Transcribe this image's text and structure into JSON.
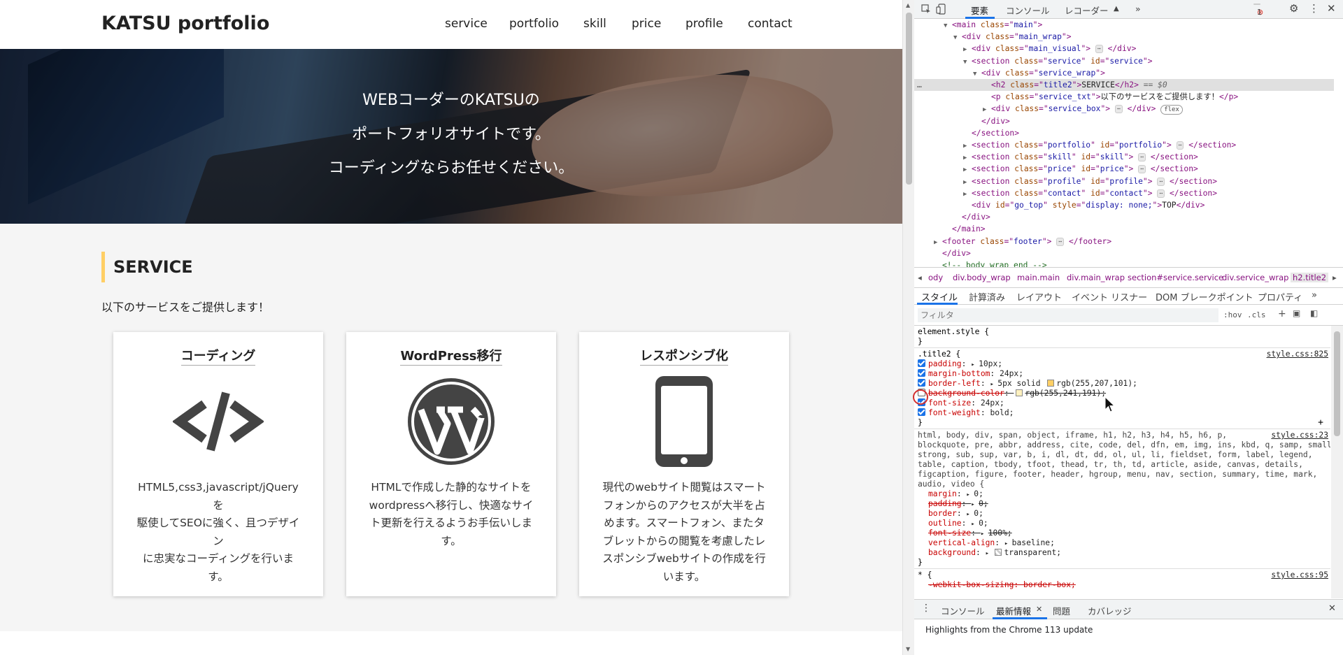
{
  "site": {
    "logo": "KATSU portfolio",
    "nav": [
      "service",
      "portfolio",
      "skill",
      "price",
      "profile",
      "contact"
    ],
    "hero_lines": [
      "WEBコーダーのKATSUの",
      "ポートフォリオサイトです。",
      "コーディングならお任せください。"
    ],
    "service_title": "SERVICE",
    "service_txt": "以下のサービスをご提供します！",
    "cards": [
      {
        "title": "コーディング",
        "icon": "code-icon",
        "desc": [
          "HTML5,css3,javascript/jQueryを",
          "駆使してSEOに強く、且つデザイン",
          "に忠実なコーディングを行いま",
          "す。"
        ]
      },
      {
        "title": "WordPress移行",
        "icon": "wordpress-icon",
        "desc": [
          "HTMLで作成した静的なサイトを",
          "wordpressへ移行し、快適なサイ",
          "ト更新を行えるようお手伝いしま",
          "す。"
        ]
      },
      {
        "title": "レスポンシブ化",
        "icon": "smartphone-icon",
        "desc": [
          "現代のwebサイト閲覧はスマート",
          "フォンからのアクセスが大半を占",
          "めます。スマートフォン、またタ",
          "ブレットからの閲覧を考慮したレ",
          "スポンシブwebサイトの作成を行",
          "います。"
        ]
      }
    ]
  },
  "devtools": {
    "top_tabs": [
      "要素",
      "コンソール",
      "レコーダー",
      "»"
    ],
    "error_count": "1",
    "tree": [
      {
        "indent": 0,
        "tri": "▼",
        "tag": "<main",
        "attrs": [
          [
            "class",
            "main"
          ]
        ],
        "close": ">",
        "after": ""
      },
      {
        "indent": 1,
        "tri": "▼",
        "tag": "<div",
        "attrs": [
          [
            "class",
            "main_wrap"
          ]
        ],
        "close": ">",
        "after": ""
      },
      {
        "indent": 2,
        "tri": "▶",
        "tag": "<div",
        "attrs": [
          [
            "class",
            "main_visual"
          ]
        ],
        "close": ">",
        "after": "</div>",
        "ell": true
      },
      {
        "indent": 2,
        "tri": "▼",
        "tag": "<section",
        "attrs": [
          [
            "class",
            "service"
          ],
          [
            "id",
            "service"
          ]
        ],
        "close": ">",
        "after": ""
      },
      {
        "indent": 3,
        "tri": "▼",
        "tag": "<div",
        "attrs": [
          [
            "class",
            "service_wrap"
          ]
        ],
        "close": ">",
        "after": ""
      },
      {
        "indent": 4,
        "tri": "",
        "tag": "<h2",
        "attrs": [
          [
            "class",
            "title2"
          ]
        ],
        "close": ">",
        "text": "SERVICE",
        "after": "</h2>",
        "selected": true,
        "suffix": " == $0"
      },
      {
        "indent": 4,
        "tri": "",
        "tag": "<p",
        "attrs": [
          [
            "class",
            "service_txt"
          ]
        ],
        "close": ">",
        "text": "以下のサービスをご提供します！",
        "after": "</p>"
      },
      {
        "indent": 4,
        "tri": "▶",
        "tag": "<div",
        "attrs": [
          [
            "class",
            "service_box"
          ]
        ],
        "close": ">",
        "after": "</div>",
        "ell": true,
        "badge": "flex"
      },
      {
        "indent": 3,
        "tri": "",
        "tag": "</div>",
        "attrs": [],
        "close": "",
        "after": ""
      },
      {
        "indent": 2,
        "tri": "",
        "tag": "</section>",
        "attrs": [],
        "close": "",
        "after": ""
      },
      {
        "indent": 2,
        "tri": "▶",
        "tag": "<section",
        "attrs": [
          [
            "class",
            "portfolio"
          ],
          [
            "id",
            "portfolio"
          ]
        ],
        "close": ">",
        "after": "</section>",
        "ell": true
      },
      {
        "indent": 2,
        "tri": "▶",
        "tag": "<section",
        "attrs": [
          [
            "class",
            "skill"
          ],
          [
            "id",
            "skill"
          ]
        ],
        "close": ">",
        "after": "</section>",
        "ell": true
      },
      {
        "indent": 2,
        "tri": "▶",
        "tag": "<section",
        "attrs": [
          [
            "class",
            "price"
          ],
          [
            "id",
            "price"
          ]
        ],
        "close": ">",
        "after": "</section>",
        "ell": true
      },
      {
        "indent": 2,
        "tri": "▶",
        "tag": "<section",
        "attrs": [
          [
            "class",
            "profile"
          ],
          [
            "id",
            "profile"
          ]
        ],
        "close": ">",
        "after": "</section>",
        "ell": true
      },
      {
        "indent": 2,
        "tri": "▶",
        "tag": "<section",
        "attrs": [
          [
            "class",
            "contact"
          ],
          [
            "id",
            "contact"
          ]
        ],
        "close": ">",
        "after": "</section>",
        "ell": true
      },
      {
        "indent": 2,
        "tri": "",
        "tag": "<div",
        "attrs": [
          [
            "id",
            "go_top"
          ],
          [
            "style",
            "display: none;"
          ]
        ],
        "close": ">",
        "text": "TOP",
        "after": "</div>"
      },
      {
        "indent": 1,
        "tri": "",
        "tag": "</div>",
        "attrs": [],
        "close": "",
        "after": ""
      },
      {
        "indent": 0,
        "tri": "",
        "tag": "</main>",
        "attrs": [],
        "close": "",
        "after": ""
      },
      {
        "indent": -1,
        "tri": "▶",
        "tag": "<footer",
        "attrs": [
          [
            "class",
            "footer"
          ]
        ],
        "close": ">",
        "after": "</footer>",
        "ell": true
      },
      {
        "indent": -1,
        "tri": "",
        "tag": "</div>",
        "attrs": [],
        "close": "",
        "after": ""
      },
      {
        "indent": -1,
        "tri": "",
        "tag": "",
        "attrs": [],
        "close": "",
        "comment": "<!-- body_wrap end -->",
        "after": ""
      }
    ],
    "breadcrumbs": [
      "ody",
      "div.body_wrap",
      "main.main",
      "div.main_wrap",
      "section#service.service",
      "div.service_wrap",
      "h2.title2"
    ],
    "style_tabs": [
      "スタイル",
      "計算済み",
      "レイアウト",
      "イベント リスナー",
      "DOM ブレークポイント",
      "プロパティ",
      "»"
    ],
    "filter_placeholder": "フィルタ",
    "hov": ":hov",
    "cls": ".cls",
    "plus": "+",
    "element_style": "element.style {",
    "rule_close": "}",
    "rule1": {
      "selector": ".title2 {",
      "source": "style.css:825",
      "props": [
        {
          "name": "padding",
          "value": "10px;",
          "checked": true,
          "tri": true
        },
        {
          "name": "margin-bottom",
          "value": "24px;",
          "checked": true
        },
        {
          "name": "border-left",
          "value": "5px solid",
          "value2": "rgb(255,207,101);",
          "checked": true,
          "tri": true,
          "swatch": "#ffcf65"
        },
        {
          "name": "background-color",
          "value": "rgb(255,241,191);",
          "checked": false,
          "swatch": "#fff1bf"
        },
        {
          "name": "font-size",
          "value": "24px;",
          "checked": true
        },
        {
          "name": "font-weight",
          "value": "bold;",
          "checked": true
        }
      ]
    },
    "rule2": {
      "selector_lines": [
        "html, body, div, span, object, iframe, h1, h2, h3, h4, h5, h6, p,",
        "blockquote, pre, abbr, address, cite, code, del, dfn, em, img, ins, kbd, q, samp, small,",
        "strong, sub, sup, var, b, i, dl, dt, dd, ol, ul, li, fieldset, form, label, legend,",
        "table, caption, tbody, tfoot, thead, tr, th, td, article, aside, canvas, details,",
        "figcaption, figure, footer, header, hgroup, menu, nav, section, summary, time, mark,",
        "audio, video {"
      ],
      "source": "style.css:23",
      "props": [
        {
          "name": "margin",
          "value": "0;",
          "strike": false
        },
        {
          "name": "padding",
          "value": "0;",
          "strike": true
        },
        {
          "name": "border",
          "value": "0;",
          "strike": false
        },
        {
          "name": "outline",
          "value": "0;",
          "strike": false
        },
        {
          "name": "font-size",
          "value": "100%;",
          "strike": true
        },
        {
          "name": "vertical-align",
          "value": "baseline;",
          "strike": false
        },
        {
          "name": "background",
          "value": "transparent;",
          "strike": false,
          "swatch": "transparent"
        }
      ]
    },
    "rule3": {
      "selector": "* {",
      "source": "style.css:95",
      "prop": "-webkit-box-sizing: border-box;"
    },
    "drawer_tabs": [
      "コンソール",
      "最新情報",
      "問題",
      "カバレッジ"
    ],
    "drawer_text": "Highlights from the Chrome 113 update"
  }
}
